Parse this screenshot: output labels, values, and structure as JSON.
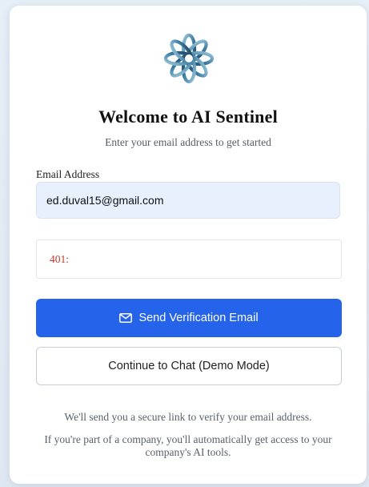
{
  "header": {
    "logo_icon": "flower-swirl-logo-icon",
    "title": "Welcome to AI Sentinel",
    "subtitle": "Enter your email address to get started"
  },
  "form": {
    "email_label": "Email Address",
    "email_value": "ed.duval15@gmail.com",
    "error_message": "401:",
    "send_button_icon": "mail-icon",
    "send_button_label": "Send Verification Email",
    "demo_button_label": "Continue to Chat (Demo Mode)"
  },
  "footer": {
    "note_1": "We'll send you a secure link to verify your email address.",
    "note_2": "If you're part of a company, you'll automatically get access to your company's AI tools."
  },
  "colors": {
    "primary": "#2563eb",
    "error": "#c0392b",
    "input_bg": "#e8f0fe"
  }
}
